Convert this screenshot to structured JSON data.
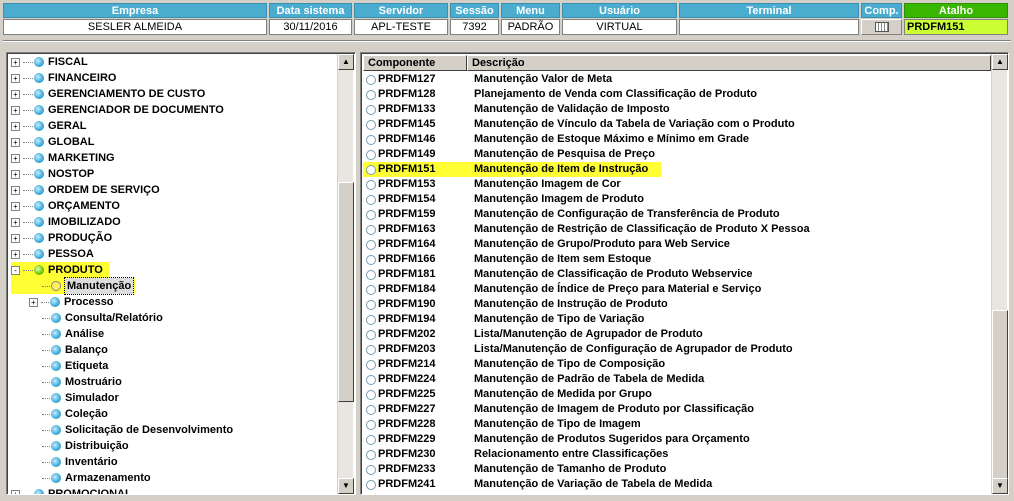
{
  "header": {
    "columns": [
      {
        "label": "Empresa",
        "value": "SESLER ALMEIDA"
      },
      {
        "label": "Data sistema",
        "value": "30/11/2016"
      },
      {
        "label": "Servidor",
        "value": "APL-TESTE"
      },
      {
        "label": "Sessão",
        "value": "7392"
      },
      {
        "label": "Menu",
        "value": "PADRÃO"
      },
      {
        "label": "Usuário",
        "value": "VIRTUAL"
      },
      {
        "label": "Terminal",
        "value": ""
      }
    ],
    "comp_label": "Comp.",
    "atalho_label": "Atalho",
    "atalho_value": "PRDFM151",
    "colors": {
      "header_blue": "#4aaccf",
      "atalho_green": "#39b600",
      "atalho_field": "#ccff33",
      "highlight": "#ffff33"
    }
  },
  "tree": {
    "items": [
      {
        "label": "FISCAL",
        "expander": "+"
      },
      {
        "label": "FINANCEIRO",
        "expander": "+"
      },
      {
        "label": "GERENCIAMENTO DE CUSTO",
        "expander": "+"
      },
      {
        "label": "GERENCIADOR DE DOCUMENTO",
        "expander": "+"
      },
      {
        "label": "GERAL",
        "expander": "+"
      },
      {
        "label": "GLOBAL",
        "expander": "+"
      },
      {
        "label": "MARKETING",
        "expander": "+"
      },
      {
        "label": "NOSTOP",
        "expander": "+"
      },
      {
        "label": "ORDEM DE SERVIÇO",
        "expander": "+"
      },
      {
        "label": "ORÇAMENTO",
        "expander": "+"
      },
      {
        "label": "IMOBILIZADO",
        "expander": "+"
      },
      {
        "label": "PRODUÇÃO",
        "expander": "+"
      },
      {
        "label": "PESSOA",
        "expander": "+"
      },
      {
        "label": "PRODUTO",
        "expander": "-"
      }
    ],
    "children": [
      {
        "label": "Manutenção",
        "selected": true
      },
      {
        "label": "Processo",
        "expander": "+"
      },
      {
        "label": "Consulta/Relatório"
      },
      {
        "label": "Análise"
      },
      {
        "label": "Balanço"
      },
      {
        "label": "Etiqueta"
      },
      {
        "label": "Mostruário"
      },
      {
        "label": "Simulador"
      },
      {
        "label": "Coleção"
      },
      {
        "label": "Solicitação de Desenvolvimento"
      },
      {
        "label": "Distribuição"
      },
      {
        "label": "Inventário"
      },
      {
        "label": "Armazenamento"
      }
    ],
    "last_item": "PROMOCIONAL"
  },
  "list": {
    "columns": [
      "Componente",
      "Descrição"
    ],
    "selected_index": 6,
    "rows": [
      [
        "PRDFM127",
        "Manutenção Valor de Meta"
      ],
      [
        "PRDFM128",
        "Planejamento de Venda com Classificação de Produto"
      ],
      [
        "PRDFM133",
        "Manutenção de Validação de Imposto"
      ],
      [
        "PRDFM145",
        "Manutenção de Vínculo da Tabela de Variação com o Produto"
      ],
      [
        "PRDFM146",
        "Manutenção de Estoque Máximo e Mínimo em Grade"
      ],
      [
        "PRDFM149",
        "Manutenção de Pesquisa de Preço"
      ],
      [
        "PRDFM151",
        "Manutenção de Item de Instrução"
      ],
      [
        "PRDFM153",
        "Manutenção Imagem de Cor"
      ],
      [
        "PRDFM154",
        "Manutenção Imagem de Produto"
      ],
      [
        "PRDFM159",
        "Manutenção de Configuração de Transferência de Produto"
      ],
      [
        "PRDFM163",
        "Manutenção de Restrição de Classificação de Produto X Pessoa"
      ],
      [
        "PRDFM164",
        "Manutenção de Grupo/Produto para Web Service"
      ],
      [
        "PRDFM166",
        "Manutenção de Item sem Estoque"
      ],
      [
        "PRDFM181",
        "Manutenção de Classificação de Produto Webservice"
      ],
      [
        "PRDFM184",
        "Manutenção de Índice de Preço para Material e Serviço"
      ],
      [
        "PRDFM190",
        "Manutenção de Instrução de Produto"
      ],
      [
        "PRDFM194",
        "Manutenção de Tipo de Variação"
      ],
      [
        "PRDFM202",
        "Lista/Manutenção de Agrupador de Produto"
      ],
      [
        "PRDFM203",
        "Lista/Manutenção de Configuração de Agrupador de Produto"
      ],
      [
        "PRDFM214",
        "Manutenção de Tipo de Composição"
      ],
      [
        "PRDFM224",
        "Manutenção de Padrão de Tabela de Medida"
      ],
      [
        "PRDFM225",
        "Manutenção de Medida por Grupo"
      ],
      [
        "PRDFM227",
        "Manutenção de Imagem de Produto por Classificação"
      ],
      [
        "PRDFM228",
        "Manutenção de Tipo de Imagem"
      ],
      [
        "PRDFM229",
        "Manutenção de Produtos Sugeridos para Orçamento"
      ],
      [
        "PRDFM230",
        "Relacionamento entre Classificações"
      ],
      [
        "PRDFM233",
        "Manutenção de Tamanho de Produto"
      ],
      [
        "PRDFM241",
        "Manutenção de Variação de Tabela de Medida"
      ]
    ]
  }
}
